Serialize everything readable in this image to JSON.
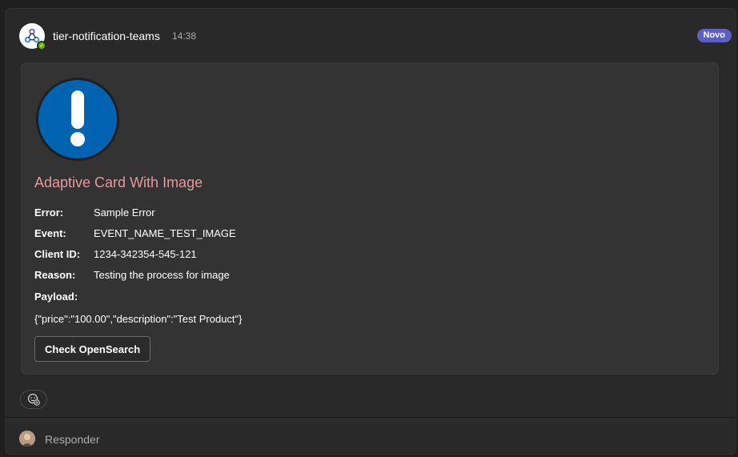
{
  "message": {
    "sender": "tier-notification-teams",
    "time": "14:38",
    "badge": "Novo",
    "avatar_icon": "webhook-icon",
    "presence": "available"
  },
  "card": {
    "image_icon": "exclamation-circle-icon",
    "title": "Adaptive Card With Image",
    "facts": [
      {
        "key": "Error:",
        "value": "Sample Error"
      },
      {
        "key": "Event:",
        "value": "EVENT_NAME_TEST_IMAGE"
      },
      {
        "key": "Client ID:",
        "value": "1234-342354-545-121"
      },
      {
        "key": "Reason:",
        "value": "Testing the process for image"
      }
    ],
    "payload_label": "Payload:",
    "payload_value": "{\"price\":\"100.00\",\"description\":\"Test Product\"}",
    "action_label": "Check OpenSearch"
  },
  "reply": {
    "label": "Responder"
  },
  "colors": {
    "title": "#e59a9e",
    "badge": "#5b5fc7",
    "alert_blue": "#0063b1",
    "presence": "#6bb700"
  }
}
